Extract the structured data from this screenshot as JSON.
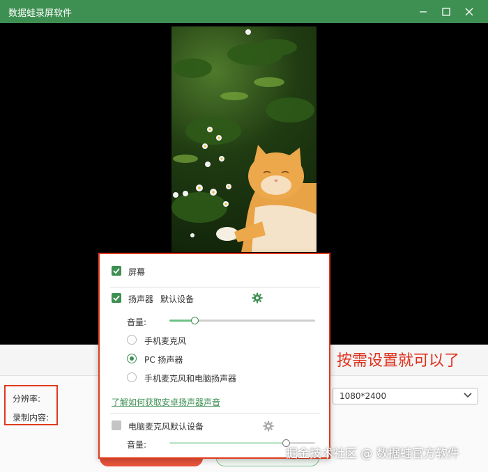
{
  "window": {
    "title": "数据蛙录屏软件",
    "minimize_icon": "minimize-icon",
    "maximize_icon": "maximize-icon",
    "close_icon": "close-icon"
  },
  "settings": {
    "resolution_label": "分辨率:",
    "content_label": "录制内容:",
    "resolution_value": "1080*2400"
  },
  "popup": {
    "screen_label": "屏幕",
    "speaker_label": "扬声器",
    "speaker_device": "默认设备",
    "volume_label": "音量:",
    "speaker_volume": 0.17,
    "audio_options": [
      "手机麦克风",
      "PC 扬声器",
      "手机麦克风和电脑扬声器"
    ],
    "selected_option": "PC 扬声器",
    "help_link": "了解如何获取安卓扬声器声音",
    "mic_label": "电脑麦克风默认设备",
    "mic_volume": 0.8
  },
  "annotation": "按需设置就可以了",
  "watermark": "掘金技术社区 @ 数据蛙官方软件",
  "colors": {
    "accent": "#3d8f52",
    "highlight_border": "#e03a1e",
    "annotation": "#e0301e"
  }
}
